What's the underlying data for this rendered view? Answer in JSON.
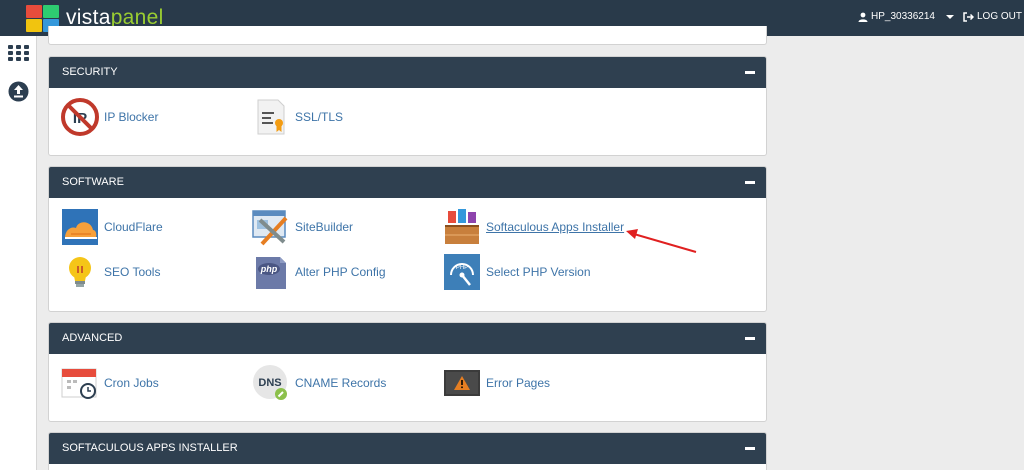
{
  "brand": {
    "name_part1": "vista",
    "name_part2": "panel",
    "logo_colors": [
      "#e74c3c",
      "#2ecc71",
      "#f1c40f",
      "#3498db"
    ]
  },
  "header": {
    "username": "HP_30336214",
    "logout_label": "LOG OUT"
  },
  "sidebar": {
    "items": [
      {
        "icon": "apps-grid-icon"
      },
      {
        "icon": "upload-icon"
      }
    ]
  },
  "sections": {
    "security": {
      "title": "SECURITY",
      "items": [
        {
          "label": "IP Blocker",
          "icon": "ip-blocker-icon"
        },
        {
          "label": "SSL/TLS",
          "icon": "ssl-certificate-icon"
        }
      ]
    },
    "software": {
      "title": "SOFTWARE",
      "items": [
        {
          "label": "CloudFlare",
          "icon": "cloudflare-icon"
        },
        {
          "label": "SiteBuilder",
          "icon": "sitebuilder-icon"
        },
        {
          "label": "Softaculous Apps Installer",
          "icon": "softaculous-icon"
        },
        {
          "label": "SEO Tools",
          "icon": "lightbulb-icon"
        },
        {
          "label": "Alter PHP Config",
          "icon": "php-config-icon"
        },
        {
          "label": "Select PHP Version",
          "icon": "php-version-icon"
        }
      ]
    },
    "advanced": {
      "title": "ADVANCED",
      "items": [
        {
          "label": "Cron Jobs",
          "icon": "cron-calendar-icon"
        },
        {
          "label": "CNAME Records",
          "icon": "dns-icon"
        },
        {
          "label": "Error Pages",
          "icon": "error-warning-icon"
        }
      ]
    },
    "softaculous": {
      "title": "SOFTACULOUS APPS INSTALLER"
    }
  },
  "colors": {
    "topbar": "#293a4a",
    "panel_header": "#2f4050",
    "link": "#3e74a8",
    "annotation_arrow": "#e02020"
  }
}
